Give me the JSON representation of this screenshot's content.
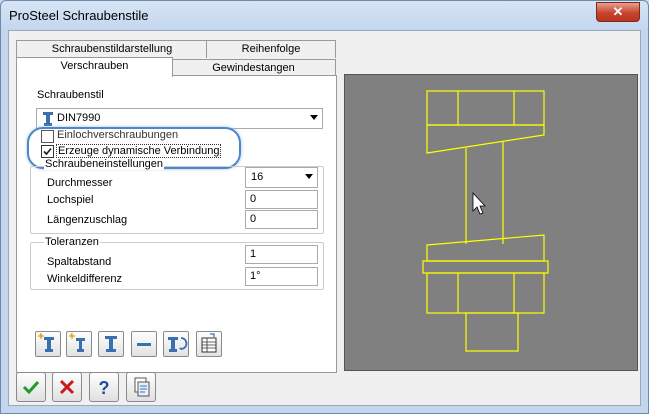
{
  "window": {
    "title": "ProSteel Schraubenstile",
    "close_symbol": "✕"
  },
  "tabs": {
    "back_row": [
      "Schraubenstildarstellung",
      "Reihenfolge"
    ],
    "front_row": [
      "Verschrauben",
      "Gewindestangen"
    ],
    "active": "Verschrauben"
  },
  "form": {
    "style_label": "Schraubenstil",
    "style_value": "DIN7990",
    "checkbox_single": {
      "label": "Einlochverschraubungen",
      "checked": false
    },
    "checkbox_dynamic": {
      "label": "Erzeuge dynamische Verbindung",
      "checked": true
    },
    "bolt_group": {
      "title": "Schraubeneinstellungen",
      "diameter_label": "Durchmesser",
      "diameter_value": "16",
      "hole_clearance_label": "Lochspiel",
      "hole_clearance_value": "0",
      "length_addition_label": "Längenzuschlag",
      "length_addition_value": "0"
    },
    "tolerance_group": {
      "title": "Toleranzen",
      "gap_label": "Spaltabstand",
      "gap_value": "1",
      "angle_label": "Winkeldifferenz",
      "angle_value": "1°"
    }
  },
  "colors": {
    "accent": "#3a6fb0",
    "preview_bg": "#808080",
    "preview_lines": "#ffff00",
    "highlight": "#4f86c6"
  }
}
